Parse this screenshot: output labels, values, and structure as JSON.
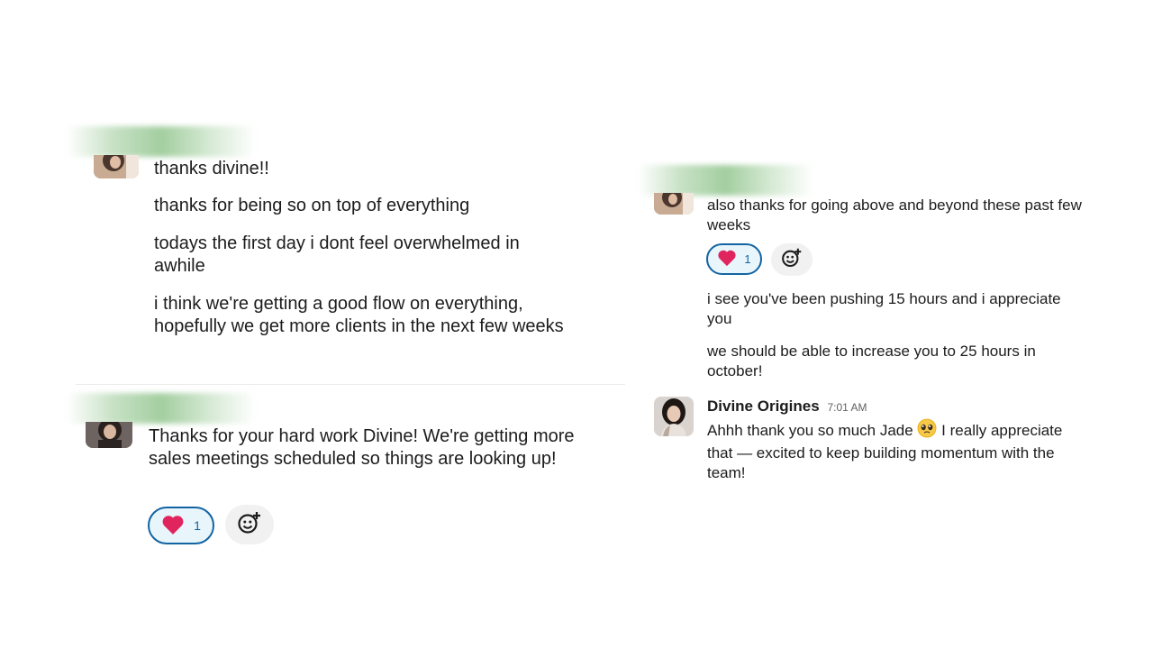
{
  "left_thread": {
    "messages": [
      "thanks divine!!",
      "thanks for being so on top of everything",
      "todays the first day i dont feel overwhelmed in awhile",
      "i think we're getting a good flow on everything, hopefully we get more clients in the next few weeks"
    ],
    "reply": {
      "text": "Thanks for your hard work Divine! We're getting more sales meetings scheduled so things are looking up!",
      "reaction": {
        "emoji": "heart-emoji",
        "count": "1"
      }
    }
  },
  "right_thread": {
    "messages": [
      "also thanks for going above and beyond these past few weeks",
      "i see you've been pushing 15 hours and i appreciate you",
      "we should be able to increase you to 25 hours in october!"
    ],
    "reaction": {
      "emoji": "heart-emoji",
      "count": "1"
    },
    "reply": {
      "sender": "Divine Origines",
      "time": "7:01 AM",
      "text_before_emoji": "Ahhh thank you so much Jade",
      "emoji": "pleading-face-emoji",
      "text_after_emoji": "I really appreciate that — excited to keep building momentum with the team!"
    }
  },
  "colors": {
    "text": "#1d1c1d",
    "reaction_border": "#1264a3",
    "reaction_bg": "#e8f5fa",
    "heart": "#e0245e",
    "name_blur": "#84be80"
  }
}
